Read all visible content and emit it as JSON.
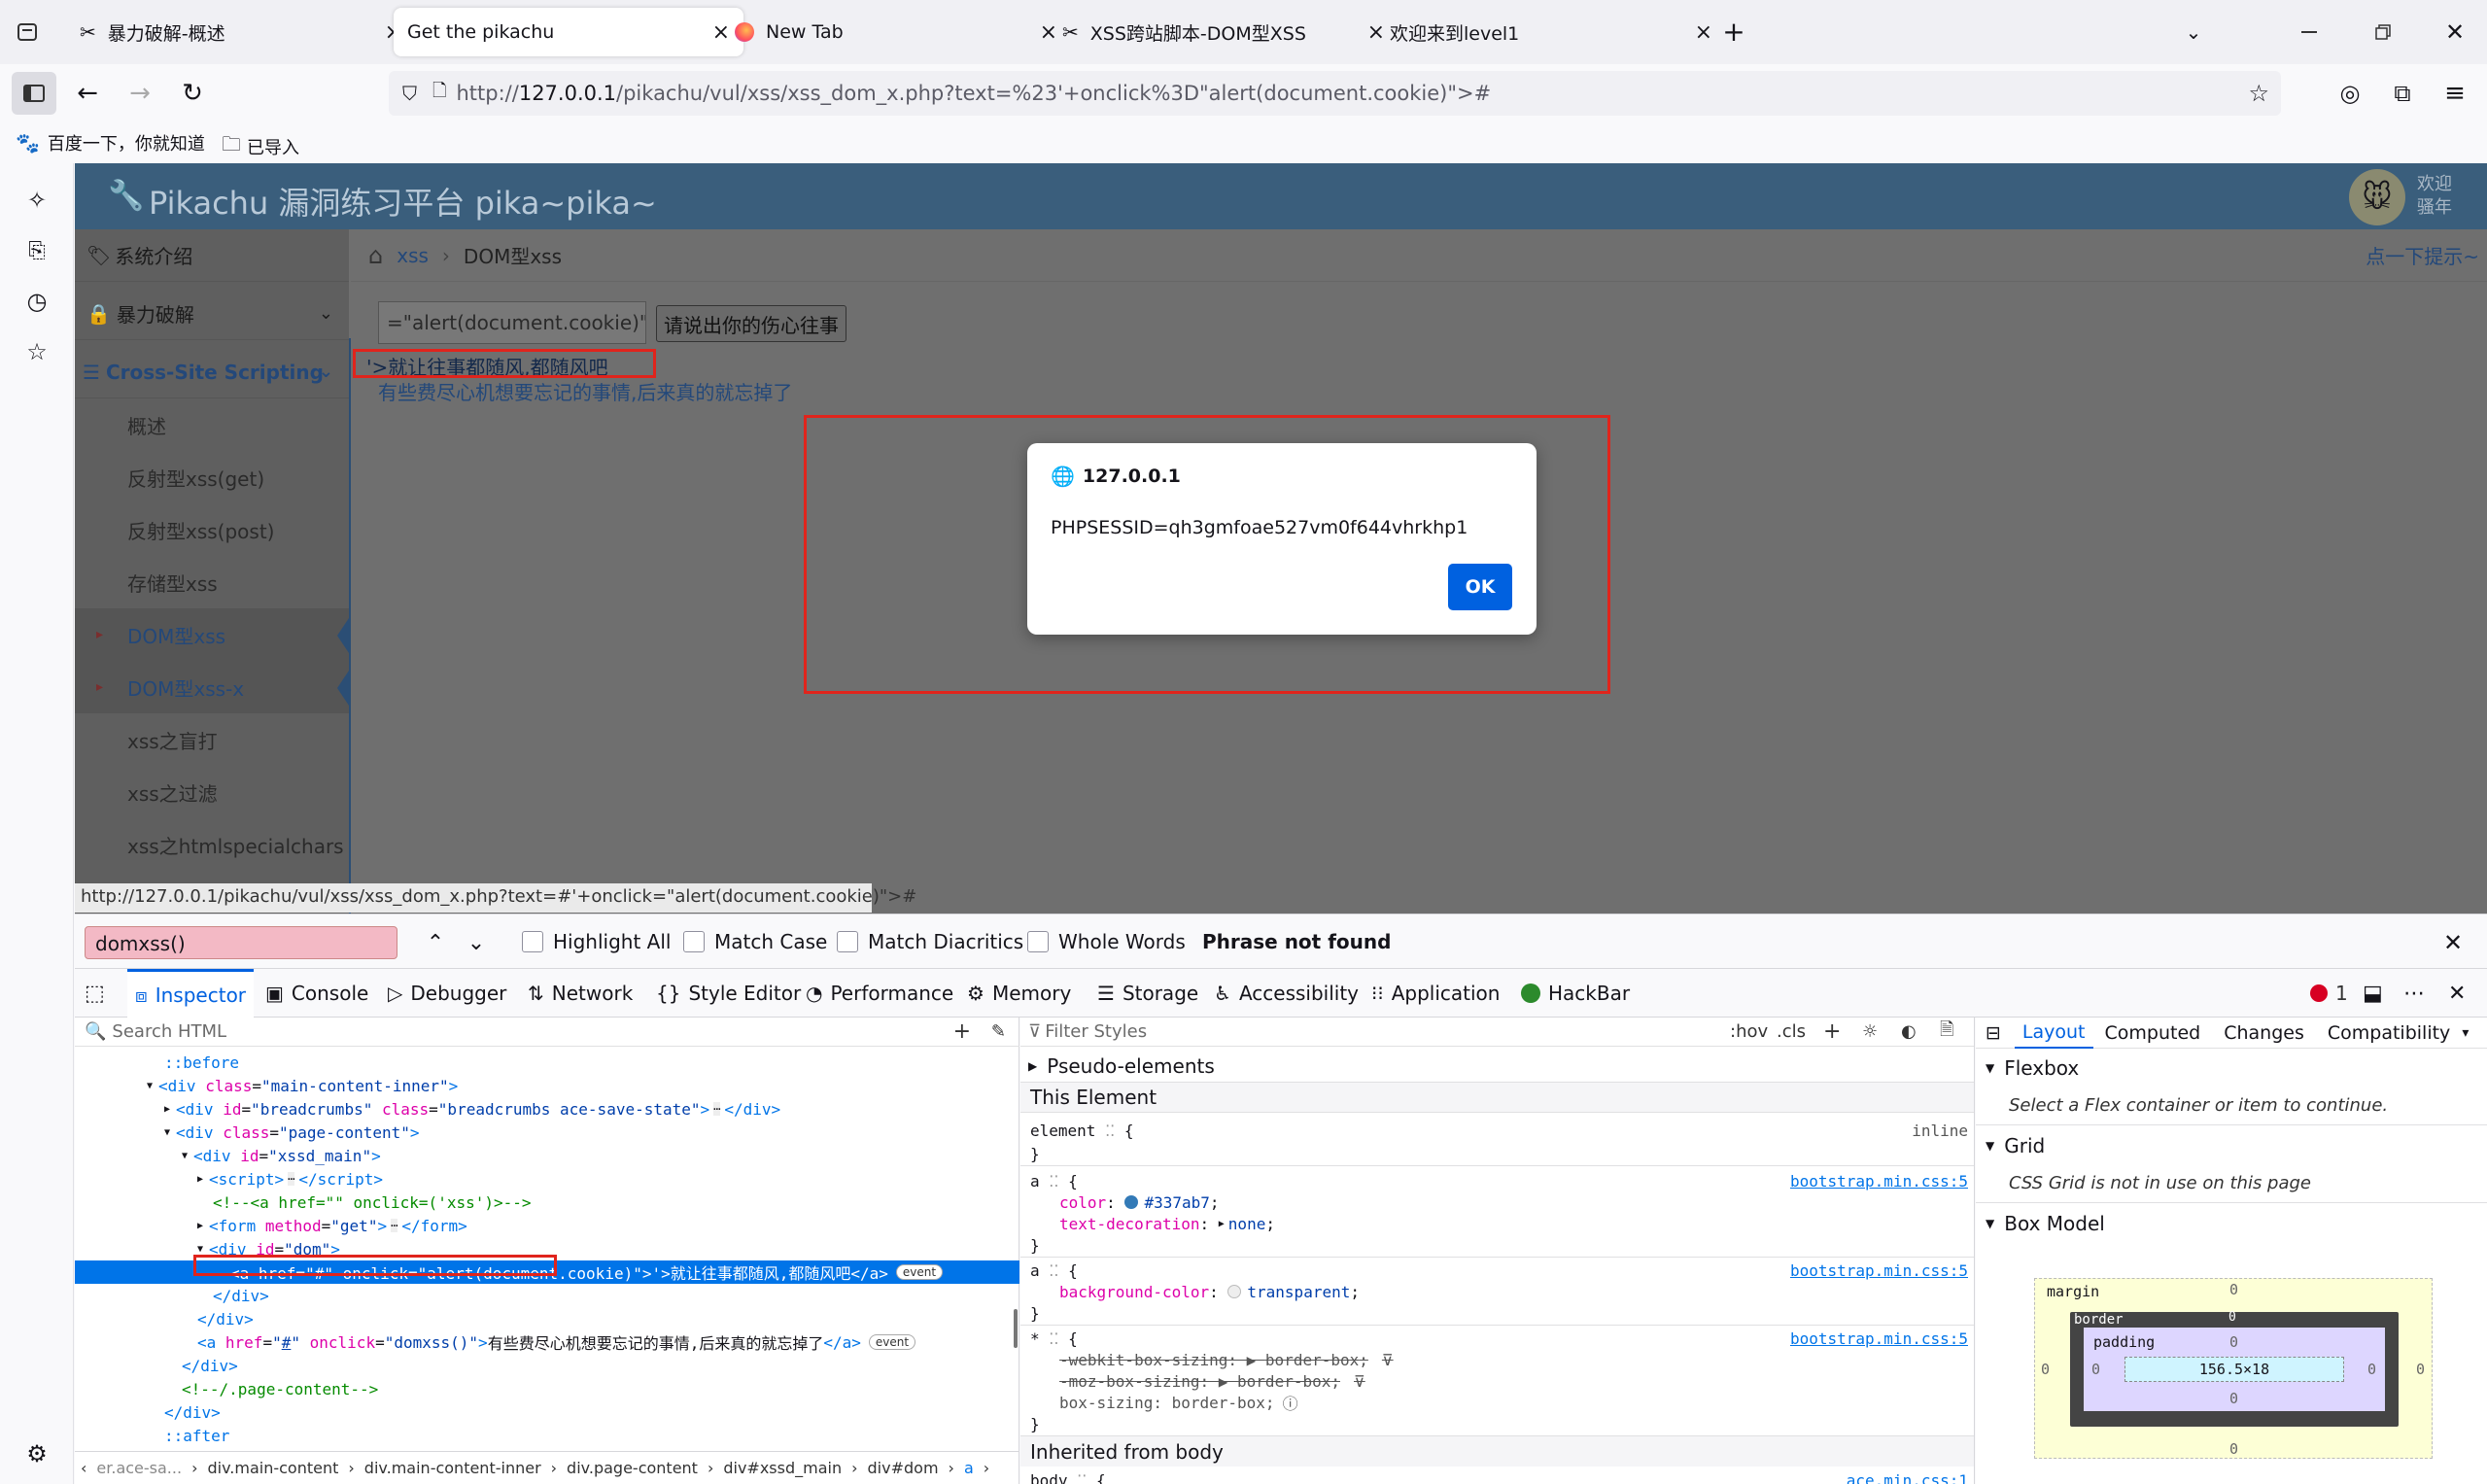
{
  "browser": {
    "tabs": [
      {
        "label": "暴力破解-概述",
        "active": false
      },
      {
        "label": "Get the pikachu",
        "active": true
      },
      {
        "label": "New Tab",
        "active": false
      },
      {
        "label": "XSS跨站脚本-DOM型XSS",
        "active": false
      },
      {
        "label": "欢迎来到level1",
        "active": false
      }
    ],
    "url_prefix": "http://",
    "url_host": "127.0.0.1",
    "url_rest": "/pikachu/vul/xss/xss_dom_x.php?text=%23'+onclick%3D\"alert(document.cookie)\">#",
    "bookmarks": [
      "百度一下，你就知道",
      "已导入"
    ],
    "close_glyph": "×",
    "new_tab_glyph": "+"
  },
  "site": {
    "title": "Pikachu 漏洞练习平台 pika~pika~",
    "welcome_line1": "欢迎",
    "welcome_line2": "骚年",
    "menu": [
      {
        "label": "系统介绍"
      },
      {
        "label": "暴力破解"
      },
      {
        "label": "Cross-Site Scripting"
      }
    ],
    "submenu": [
      "概述",
      "反射型xss(get)",
      "反射型xss(post)",
      "存储型xss",
      "DOM型xss",
      "DOM型xss-x",
      "xss之盲打",
      "xss之过滤",
      "xss之htmlspecialchars"
    ],
    "breadcrumb_home": "xss",
    "breadcrumb_sep": "›",
    "breadcrumb_current": "DOM型xss",
    "hint": "点一下提示~",
    "input_value": "=\"alert(document.cookie)\">",
    "submit_label": "请说出你的伤心往事",
    "link1": "'>就让往事都随风,都随风吧",
    "link2": "有些费尽心机想要忘记的事情,后来真的就忘掉了",
    "status_url": "http://127.0.0.1/pikachu/vul/xss/xss_dom_x.php?text=#'+onclick=\"alert(document.cookie)\">#"
  },
  "alert": {
    "origin": "127.0.0.1",
    "message": "PHPSESSID=qh3gmfoae527vm0f644vhrkhp1",
    "ok": "OK"
  },
  "findbar": {
    "query": "domxss()",
    "options": [
      "Highlight All",
      "Match Case",
      "Match Diacritics",
      "Whole Words"
    ],
    "result": "Phrase not found"
  },
  "devtools": {
    "tabs": [
      "Inspector",
      "Console",
      "Debugger",
      "Network",
      "Style Editor",
      "Performance",
      "Memory",
      "Storage",
      "Accessibility",
      "Application",
      "HackBar"
    ],
    "error_count": "1",
    "search_placeholder": "Search HTML",
    "filter_placeholder": "Filter Styles",
    "hov": ":hov",
    "cls": ".cls",
    "pseudo_elements": "Pseudo-elements",
    "this_element": "This Element",
    "inherited": "Inherited from body",
    "layout_tabs": [
      "Layout",
      "Computed",
      "Changes",
      "Compatibility"
    ],
    "flexbox": "Flexbox",
    "flex_note": "Select a Flex container or item to continue.",
    "grid": "Grid",
    "grid_note": "CSS Grid is not in use on this page",
    "box_model": "Box Model",
    "box": {
      "margin": "margin",
      "border": "border",
      "padding": "padding",
      "size": "156.5×18",
      "zero": "0"
    },
    "breadcrumbs": [
      "er.ace-sa...",
      "div.main-content",
      "div.main-content-inner",
      "div.page-content",
      "div#xssd_main",
      "div#dom",
      "a"
    ],
    "styles": {
      "element": "element",
      "inline": "inline",
      "source": "bootstrap.min.css:5",
      "color_prop": "color",
      "color_val": "#337ab7",
      "td_prop": "text-decoration",
      "td_val": "none",
      "bg_prop": "background-color",
      "bg_val": "transparent",
      "wk": "-webkit-box-sizing",
      "moz": "-moz-box-sizing",
      "bs": "box-sizing",
      "bb": "border-box",
      "body_src": "ace.min.css:1"
    }
  }
}
